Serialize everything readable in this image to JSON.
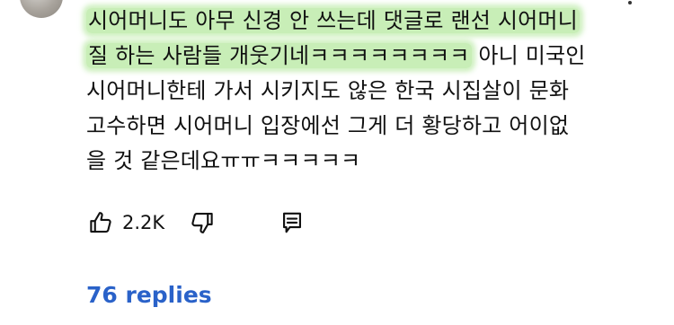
{
  "comment": {
    "lines": [
      {
        "segments": [
          {
            "text": "시어머니도 아무 신경 안 쓰는데 댓글로 랜선 시어머니",
            "highlight": true
          }
        ]
      },
      {
        "segments": [
          {
            "text": "질 하는 사람들 개웃기네ㅋㅋㅋㅋㅋㅋㅋㅋ",
            "highlight": true
          },
          {
            "text": " 아니 미국인",
            "highlight": false
          }
        ]
      },
      {
        "segments": [
          {
            "text": "시어머니한테 가서 시키지도 않은 한국 시집살이 문화",
            "highlight": false
          }
        ]
      },
      {
        "segments": [
          {
            "text": "고수하면 시어머니 입장에선 그게 더 황당하고 어이없",
            "highlight": false
          }
        ]
      },
      {
        "segments": [
          {
            "text": "을 것 같은데요ㅠㅠㅋㅋㅋㅋㅋ",
            "highlight": false
          }
        ]
      }
    ]
  },
  "actions": {
    "like_icon": "thumbs-up-icon",
    "like_count": "2.2K",
    "dislike_icon": "thumbs-down-icon",
    "reply_icon": "reply-comment-icon"
  },
  "replies": {
    "label": "76 replies"
  },
  "colors": {
    "highlight": "#bfeaa8",
    "replies_link": "#2a62c9",
    "text": "#111111"
  }
}
